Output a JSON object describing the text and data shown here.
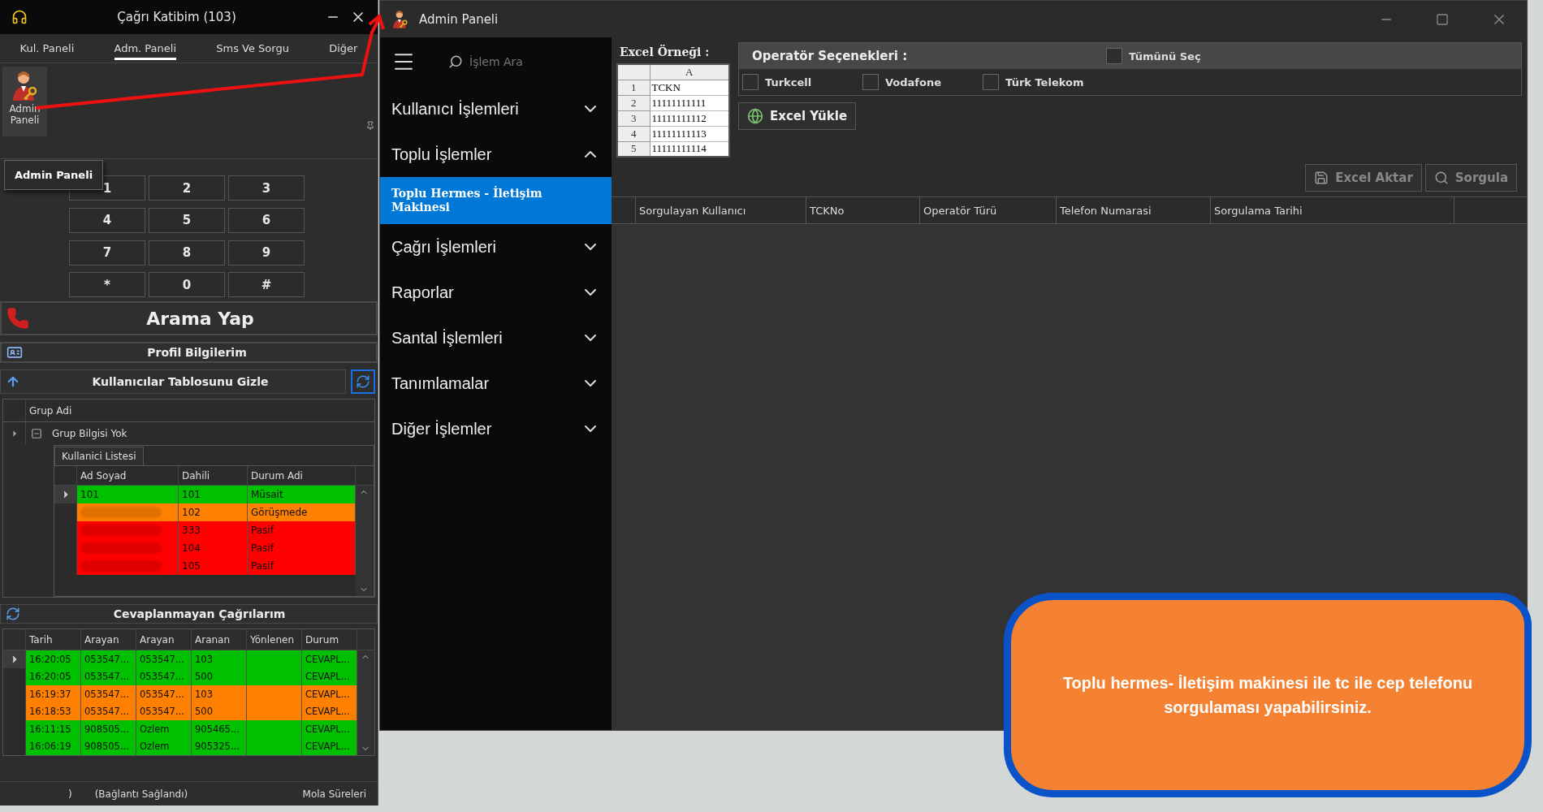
{
  "left_window": {
    "title": "Çağrı Katibim (103)",
    "tabs": [
      {
        "label": "Kul. Paneli",
        "selected": false
      },
      {
        "label": "Adm. Paneli",
        "selected": true
      },
      {
        "label": "Sms Ve Sorgu",
        "selected": false
      },
      {
        "label": "Diğer",
        "selected": false
      }
    ],
    "ribbon_button": "Admin Paneli",
    "tooltip": "Admin Paneli",
    "keypad": [
      "1",
      "2",
      "3",
      "4",
      "5",
      "6",
      "7",
      "8",
      "9",
      "*",
      "0",
      "#"
    ],
    "call_button": "Arama Yap",
    "profile_button": "Profil Bilgilerim",
    "users_toggle": "Kullanıcılar Tablosunu Gizle",
    "group_grid": {
      "column": "Grup Adi",
      "group": "Grup Bilgisi Yok",
      "expanded": true,
      "detail_tab": "Kullanici Listesi",
      "columns": [
        "Ad Soyad",
        "Dahili",
        "Durum Adi"
      ],
      "rows": [
        {
          "name": "101",
          "redacted": false,
          "ext": "101",
          "status": "Müsait",
          "color": "#00c000",
          "selected": true
        },
        {
          "redacted": true,
          "ext": "102",
          "status": "Görüşmede",
          "color": "#ff8000",
          "selected": false
        },
        {
          "redacted": true,
          "ext": "333",
          "status": "Pasif",
          "color": "#ff0000",
          "selected": false
        },
        {
          "redacted": true,
          "ext": "104",
          "status": "Pasif",
          "color": "#ff0000",
          "selected": false
        },
        {
          "redacted": true,
          "ext": "105",
          "status": "Pasif",
          "color": "#ff0000",
          "selected": false
        }
      ]
    },
    "missed_calls": {
      "title": "Cevaplanmayan Çağrılarım",
      "columns": [
        "Tarih",
        "Arayan",
        "Arayan",
        "Aranan",
        "Yönlenen",
        "Durum"
      ],
      "rows": [
        {
          "color": "#00c000",
          "selected": true,
          "cells": [
            "16:20:05",
            "053547...",
            "053547...",
            "103",
            "",
            "CEVAPL..."
          ]
        },
        {
          "color": "#00c000",
          "selected": false,
          "cells": [
            "16:20:05",
            "053547...",
            "053547...",
            "500",
            "",
            "CEVAPL..."
          ]
        },
        {
          "color": "#ff8000",
          "selected": false,
          "cells": [
            "16:19:37",
            "053547...",
            "053547...",
            "103",
            "",
            "CEVAPL..."
          ]
        },
        {
          "color": "#ff8000",
          "selected": false,
          "cells": [
            "16:18:53",
            "053547...",
            "053547...",
            "500",
            "",
            "CEVAPL..."
          ]
        },
        {
          "color": "#00c000",
          "selected": false,
          "cells": [
            "16:11:15",
            "908505...",
            "Ozlem",
            "905465...",
            "",
            "CEVAPL..."
          ]
        },
        {
          "color": "#00c000",
          "selected": false,
          "cells": [
            "16:06:19",
            "908505...",
            "Ozlem",
            "905325...",
            "",
            "CEVAPL..."
          ]
        }
      ]
    },
    "status_bar": {
      "left": ")",
      "connection": "(Bağlantı Sağlandı)",
      "right": "Mola Süreleri"
    }
  },
  "right_window": {
    "title": "Admin Paneli",
    "search": {
      "placeholder": "İşlem Ara"
    },
    "menu": [
      {
        "label": "Kullanıcı İşlemleri",
        "expanded": false
      },
      {
        "label": "Toplu İşlemler",
        "expanded": true,
        "children": [
          {
            "label": "Toplu Hermes - İletişim Makinesi",
            "selected": true
          }
        ]
      },
      {
        "label": "Çağrı İşlemleri",
        "expanded": false
      },
      {
        "label": "Raporlar",
        "expanded": false
      },
      {
        "label": "Santal İşlemleri",
        "expanded": false
      },
      {
        "label": "Tanımlamalar",
        "expanded": false
      },
      {
        "label": "Diğer İşlemler",
        "expanded": false
      }
    ],
    "excel_sample": {
      "label": "Excel Örneği :",
      "column": "A",
      "rows": [
        [
          "1",
          "TCKN"
        ],
        [
          "2",
          "11111111111"
        ],
        [
          "3",
          "11111111112"
        ],
        [
          "4",
          "11111111113"
        ],
        [
          "5",
          "11111111114"
        ]
      ]
    },
    "operators": {
      "title": "Operatör Seçenekleri :",
      "select_all": {
        "label": "Tümünü Seç",
        "checked": false
      },
      "options": [
        {
          "label": "Turkcell",
          "checked": false
        },
        {
          "label": "Vodafone",
          "checked": false
        },
        {
          "label": "Türk Telekom",
          "checked": false
        }
      ]
    },
    "upload_button": "Excel Yükle",
    "actions": [
      {
        "kind": "export",
        "label": "Excel Aktar",
        "disabled": true
      },
      {
        "kind": "query",
        "label": "Sorgula",
        "disabled": true
      }
    ],
    "columns": [
      "Sorgulayan Kullanıcı",
      "TCKNo",
      "Operatör Türü",
      "Telefon Numarasi",
      "Sorgulama Tarihi"
    ]
  },
  "callout": {
    "text": "Toplu hermes- İletişim makinesi ile tc ile cep telefonu sorgulaması yapabilirsiniz."
  }
}
